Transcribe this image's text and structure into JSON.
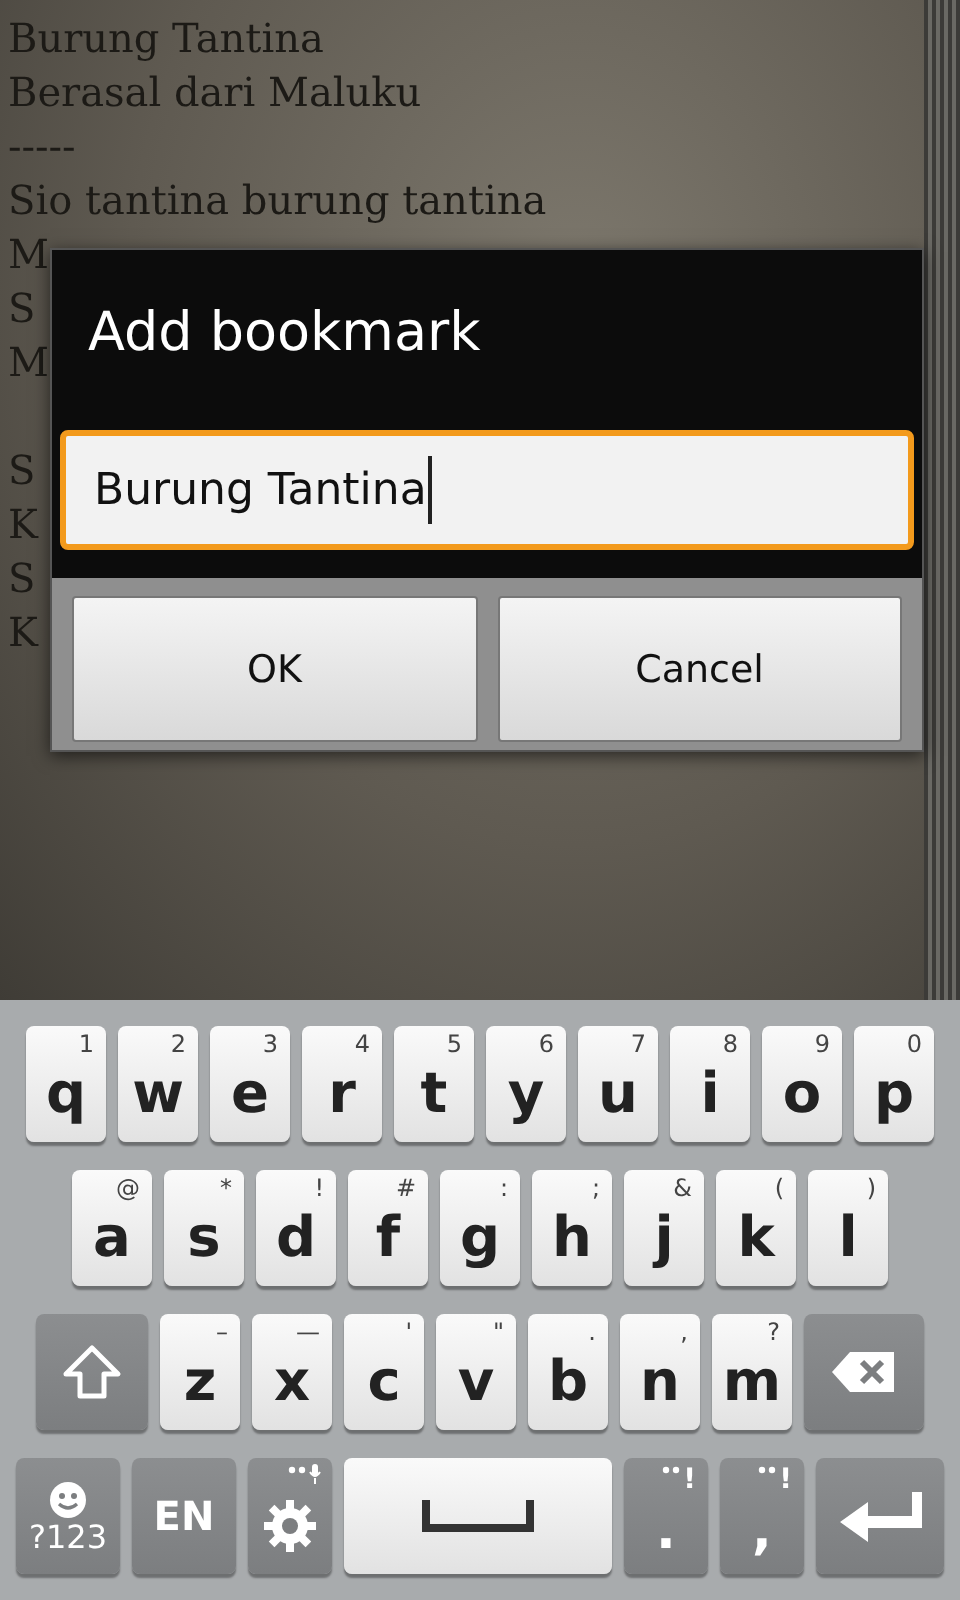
{
  "reader": {
    "stanzas": [
      {
        "lines": [
          "Burung Tantina",
          "Berasal dari Maluku",
          "-----",
          "Sio tantina burung tantina",
          "M",
          "S",
          "M"
        ]
      },
      {
        "lines": [
          "S",
          "K",
          "S",
          "K"
        ]
      }
    ]
  },
  "dialog": {
    "title": "Add bookmark",
    "field": {
      "value": "Burung Tantina",
      "focused": true
    },
    "buttons": [
      "OK",
      "Cancel"
    ]
  },
  "keyboard": {
    "rows": [
      {
        "keys": [
          {
            "kind": "letter",
            "label": "q",
            "hint": "1"
          },
          {
            "kind": "letter",
            "label": "w",
            "hint": "2"
          },
          {
            "kind": "letter",
            "label": "e",
            "hint": "3"
          },
          {
            "kind": "letter",
            "label": "r",
            "hint": "4"
          },
          {
            "kind": "letter",
            "label": "t",
            "hint": "5"
          },
          {
            "kind": "letter",
            "label": "y",
            "hint": "6"
          },
          {
            "kind": "letter",
            "label": "u",
            "hint": "7"
          },
          {
            "kind": "letter",
            "label": "i",
            "hint": "8"
          },
          {
            "kind": "letter",
            "label": "o",
            "hint": "9"
          },
          {
            "kind": "letter",
            "label": "p",
            "hint": "0"
          }
        ]
      },
      {
        "keys": [
          {
            "kind": "letter",
            "label": "a",
            "hint": "@"
          },
          {
            "kind": "letter",
            "label": "s",
            "hint": "*"
          },
          {
            "kind": "letter",
            "label": "d",
            "hint": "!"
          },
          {
            "kind": "letter",
            "label": "f",
            "hint": "#"
          },
          {
            "kind": "letter",
            "label": "g",
            "hint": ":"
          },
          {
            "kind": "letter",
            "label": "h",
            "hint": ";"
          },
          {
            "kind": "letter",
            "label": "j",
            "hint": "&"
          },
          {
            "kind": "letter",
            "label": "k",
            "hint": "("
          },
          {
            "kind": "letter",
            "label": "l",
            "hint": ")"
          }
        ]
      },
      {
        "keys": [
          {
            "kind": "shift"
          },
          {
            "kind": "letter",
            "label": "z",
            "hint": "–"
          },
          {
            "kind": "letter",
            "label": "x",
            "hint": "—"
          },
          {
            "kind": "letter",
            "label": "c",
            "hint": "'"
          },
          {
            "kind": "letter",
            "label": "v",
            "hint": "\""
          },
          {
            "kind": "letter",
            "label": "b",
            "hint": "."
          },
          {
            "kind": "letter",
            "label": "n",
            "hint": ","
          },
          {
            "kind": "letter",
            "label": "m",
            "hint": "?"
          },
          {
            "kind": "backspace"
          }
        ]
      },
      {
        "keys": [
          {
            "kind": "symbols",
            "label": "?123"
          },
          {
            "kind": "language",
            "label": "EN"
          },
          {
            "kind": "settings"
          },
          {
            "kind": "space"
          },
          {
            "kind": "punct",
            "label": ".",
            "hint": "!"
          },
          {
            "kind": "punct",
            "label": ",",
            "hint": "!"
          },
          {
            "kind": "enter"
          }
        ]
      }
    ]
  }
}
